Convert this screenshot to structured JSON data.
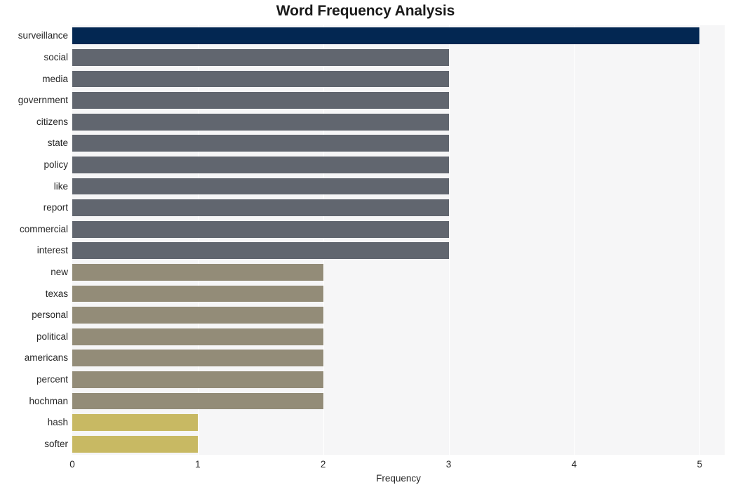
{
  "chart_data": {
    "type": "bar",
    "orientation": "horizontal",
    "title": "Word Frequency Analysis",
    "xlabel": "Frequency",
    "ylabel": "",
    "xlim": [
      0,
      5.2
    ],
    "xticks": [
      0,
      1,
      2,
      3,
      4,
      5
    ],
    "xtick_labels": [
      "0",
      "1",
      "2",
      "3",
      "4",
      "5"
    ],
    "grid": true,
    "grid_axis": "x",
    "legend": null,
    "categories": [
      "surveillance",
      "social",
      "media",
      "government",
      "citizens",
      "state",
      "policy",
      "like",
      "report",
      "commercial",
      "interest",
      "new",
      "texas",
      "personal",
      "political",
      "americans",
      "percent",
      "hochman",
      "hash",
      "softer"
    ],
    "values": [
      5,
      3,
      3,
      3,
      3,
      3,
      3,
      3,
      3,
      3,
      3,
      2,
      2,
      2,
      2,
      2,
      2,
      2,
      1,
      1
    ],
    "bar_colors": [
      "#032752",
      "#61666f",
      "#61666f",
      "#61666f",
      "#61666f",
      "#61666f",
      "#61666f",
      "#61666f",
      "#61666f",
      "#61666f",
      "#61666f",
      "#938c78",
      "#938c78",
      "#938c78",
      "#938c78",
      "#938c78",
      "#938c78",
      "#938c78",
      "#c8b963",
      "#c8b963"
    ]
  },
  "style": {
    "figure_background": "#ffffff",
    "plot_background": "#f6f6f7",
    "gridline_color": "#ffffff",
    "text_color": "#262626",
    "title_color": "#1a1a1a",
    "color_navy": "#032752",
    "color_gray": "#61666f",
    "color_khaki": "#938c78",
    "color_gold": "#c8b963"
  }
}
